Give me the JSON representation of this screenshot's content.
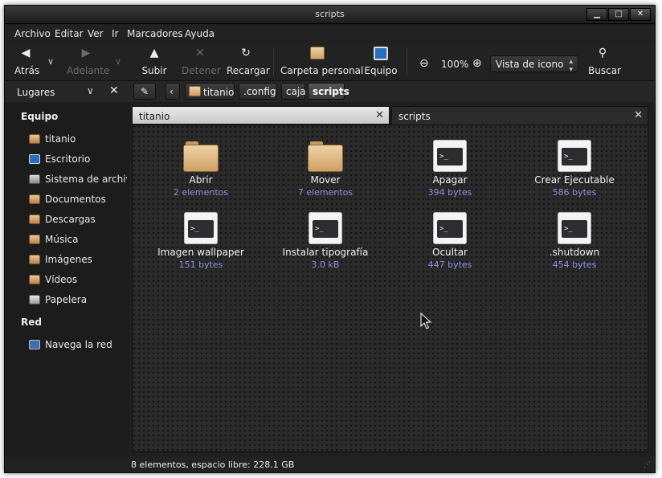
{
  "window": {
    "title": "scripts"
  },
  "menu": [
    "Archivo",
    "Editar",
    "Ver",
    "Ir",
    "Marcadores",
    "Ayuda"
  ],
  "toolbar": {
    "back": "Atrás",
    "forward": "Adelante",
    "up": "Subir",
    "stop": "Detener",
    "reload": "Recargar",
    "home": "Carpeta personal",
    "computer": "Equipo",
    "zoom": "100%",
    "view_mode": "Vista de icono",
    "search": "Buscar"
  },
  "location": {
    "places_label": "Lugares",
    "path": [
      "titanio",
      ".config",
      "caja",
      "scripts"
    ]
  },
  "sidebar": {
    "sections": [
      {
        "title": "Equipo",
        "items": [
          {
            "label": "titanio",
            "icon": "home-folder-icon"
          },
          {
            "label": "Escritorio",
            "icon": "desktop-icon"
          },
          {
            "label": "Sistema de archivos",
            "icon": "filesystem-icon"
          },
          {
            "label": "Documentos",
            "icon": "documents-folder-icon"
          },
          {
            "label": "Descargas",
            "icon": "downloads-folder-icon"
          },
          {
            "label": "Música",
            "icon": "music-folder-icon"
          },
          {
            "label": "Imágenes",
            "icon": "pictures-folder-icon"
          },
          {
            "label": "Vídeos",
            "icon": "videos-folder-icon"
          },
          {
            "label": "Papelera",
            "icon": "trash-icon"
          }
        ]
      },
      {
        "title": "Red",
        "items": [
          {
            "label": "Navega la red",
            "icon": "network-icon"
          }
        ]
      }
    ]
  },
  "tabs": [
    {
      "label": "titanio",
      "active": false
    },
    {
      "label": "scripts",
      "active": true
    }
  ],
  "files": [
    {
      "name": "Abrir",
      "info": "2 elementos",
      "type": "folder"
    },
    {
      "name": "Mover",
      "info": "7 elementos",
      "type": "folder"
    },
    {
      "name": "Apagar",
      "info": "394 bytes",
      "type": "script"
    },
    {
      "name": "Crear Ejecutable",
      "info": "586 bytes",
      "type": "script"
    },
    {
      "name": "Imagen wallpaper",
      "info": "151 bytes",
      "type": "script"
    },
    {
      "name": "Instalar tipografía",
      "info": "3.0 kB",
      "type": "script"
    },
    {
      "name": "Ocultar",
      "info": "447 bytes",
      "type": "script"
    },
    {
      "name": ".shutdown",
      "info": "454 bytes",
      "type": "script"
    }
  ],
  "status": "8 elementos, espacio libre: 228.1 GB",
  "colors": {
    "accent_size": "#8f8fe0",
    "background": "#2a2a2a"
  }
}
